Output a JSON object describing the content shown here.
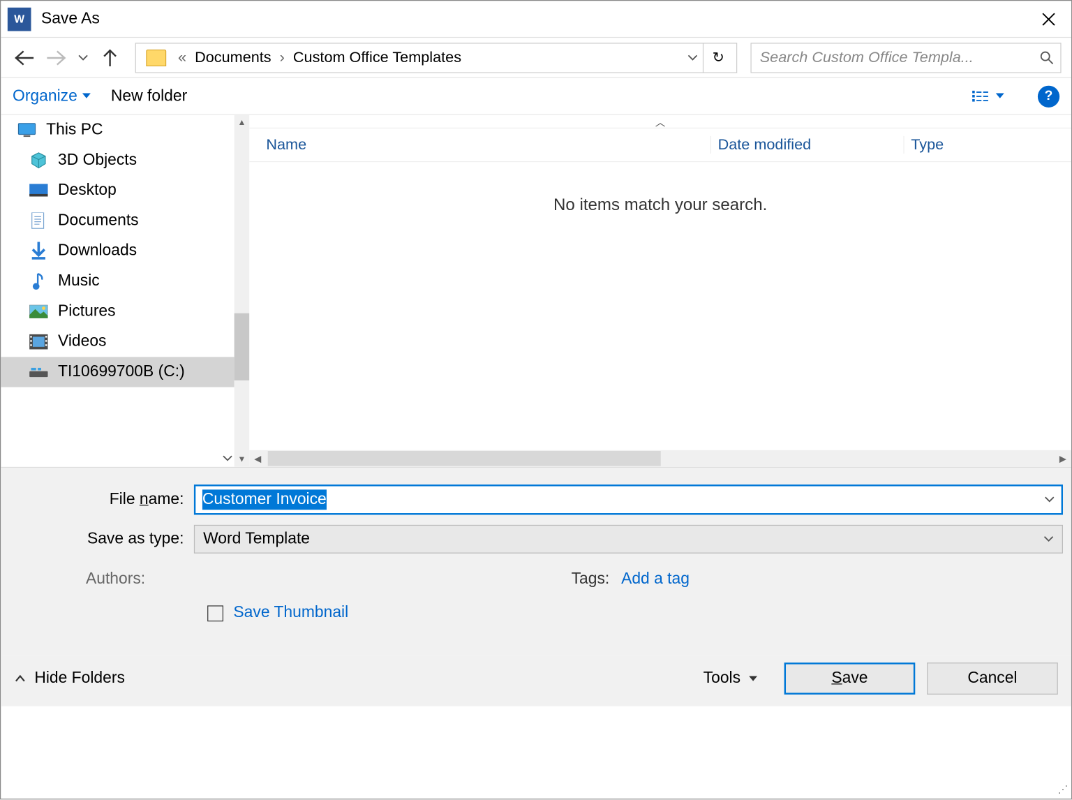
{
  "title": "Save As",
  "nav": {
    "breadcrumb_prefix": "«",
    "breadcrumb": [
      "Documents",
      "Custom Office Templates"
    ],
    "search_placeholder": "Search Custom Office Templa..."
  },
  "toolbar": {
    "organize": "Organize",
    "new_folder": "New folder"
  },
  "sidebar": {
    "top": "This PC",
    "items": [
      "3D Objects",
      "Desktop",
      "Documents",
      "Downloads",
      "Music",
      "Pictures",
      "Videos",
      "TI10699700B (C:)"
    ]
  },
  "listing": {
    "columns": [
      "Name",
      "Date modified",
      "Type"
    ],
    "empty": "No items match your search."
  },
  "form": {
    "file_name_label": "File name:",
    "file_name_value": "Customer Invoice",
    "save_type_label": "Save as type:",
    "save_type_value": "Word Template",
    "authors_label": "Authors:",
    "tags_label": "Tags:",
    "tags_link": "Add a tag",
    "save_thumbnail": "Save Thumbnail"
  },
  "footer": {
    "hide_folders": "Hide Folders",
    "tools": "Tools",
    "save": "Save",
    "cancel": "Cancel"
  }
}
